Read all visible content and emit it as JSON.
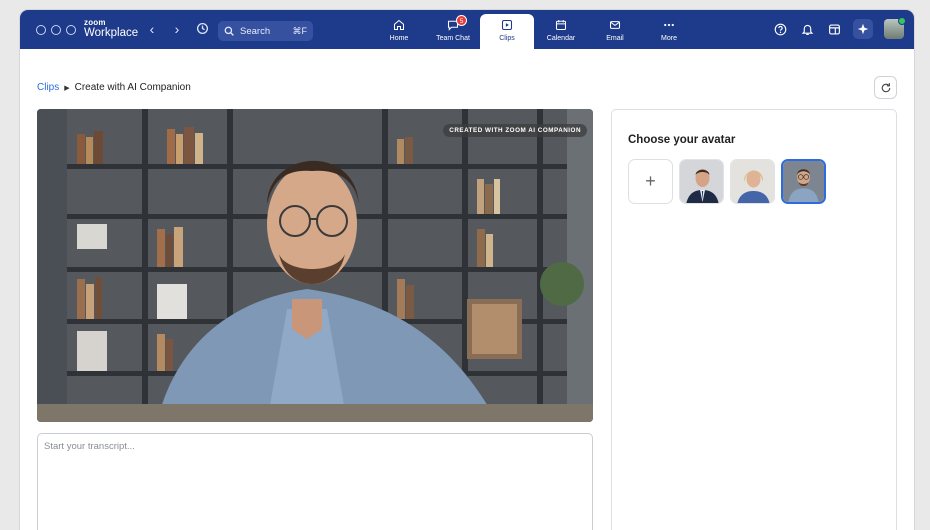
{
  "app": {
    "brand_top": "zoom",
    "brand_bottom": "Workplace"
  },
  "search": {
    "label": "Search",
    "shortcut": "⌘F"
  },
  "tabs": [
    {
      "label": "Home",
      "icon": "home-icon"
    },
    {
      "label": "Team Chat",
      "icon": "chat-icon",
      "badge": "5"
    },
    {
      "label": "Clips",
      "icon": "clips-icon",
      "active": true
    },
    {
      "label": "Calendar",
      "icon": "calendar-icon"
    },
    {
      "label": "Email",
      "icon": "email-icon"
    },
    {
      "label": "More",
      "icon": "more-icon"
    }
  ],
  "breadcrumb": {
    "root": "Clips",
    "current": "Create with AI Companion"
  },
  "video": {
    "watermark": "CREATED WITH ZOOM AI COMPANION"
  },
  "transcript": {
    "placeholder": "Start your transcript..."
  },
  "avatar_panel": {
    "title": "Choose your avatar",
    "add_symbol": "+",
    "avatars": [
      {
        "name": "avatar-man-suit",
        "selected": false
      },
      {
        "name": "avatar-woman-blonde",
        "selected": false
      },
      {
        "name": "avatar-man-glasses",
        "selected": true
      }
    ]
  },
  "colors": {
    "topbar": "#1e3a8a",
    "accent": "#2d6cdf",
    "badge": "#e23b3b"
  }
}
